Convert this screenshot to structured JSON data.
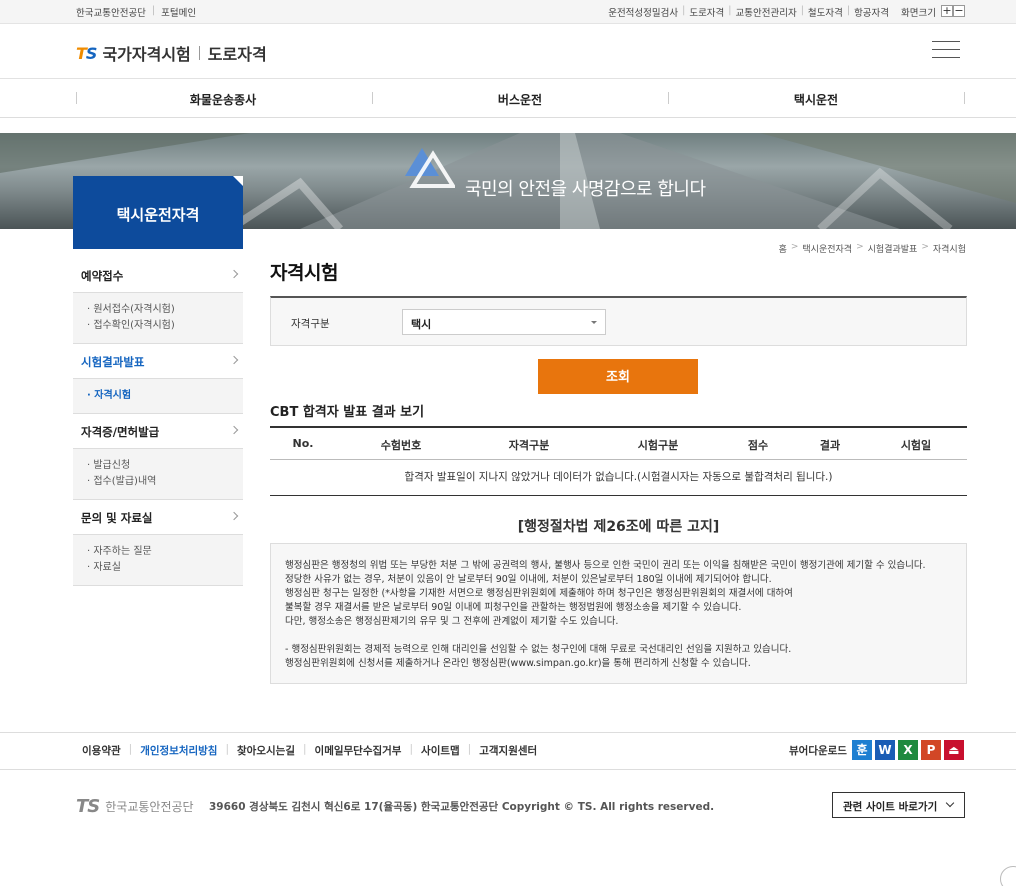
{
  "util": {
    "left_links": [
      "한국교통안전공단",
      "포털메인"
    ],
    "right_links": [
      "운전적성정밀검사",
      "도로자격",
      "교통안전관리자",
      "철도자격",
      "항공자격"
    ],
    "zoom_label": "화면크기",
    "zoom_in": "+",
    "zoom_out": "−"
  },
  "header": {
    "logo_t": "T",
    "logo_s": "S",
    "site_name": "국가자격시험",
    "section": "도로자격"
  },
  "gnb": [
    "화물운송종사",
    "버스운전",
    "택시운전"
  ],
  "hero": {
    "slogan": "국민의 안전을 사명감으로 합니다"
  },
  "side": {
    "title": "택시운전자격",
    "menu": [
      {
        "label": "예약접수",
        "subs": [
          "· 원서접수(자격시험)",
          "· 접수확인(자격시험)"
        ]
      },
      {
        "label": "시험결과발표",
        "subs": [
          "· 자격시험"
        ]
      },
      {
        "label": "자격증/면허발급",
        "subs": [
          "· 발급신청",
          "· 접수(발급)내역"
        ]
      },
      {
        "label": "문의 및 자료실",
        "subs": [
          "· 자주하는 질문",
          "· 자료실"
        ]
      }
    ]
  },
  "breadcrumb": [
    "홈",
    "택시운전자격",
    "시험결과발표",
    "자격시험"
  ],
  "page_title": "자격시험",
  "search": {
    "label": "자격구분",
    "selected": "택시",
    "button": "조회"
  },
  "results": {
    "title": "CBT 합격자 발표 결과 보기",
    "columns": [
      "No.",
      "수험번호",
      "자격구분",
      "시험구분",
      "점수",
      "결과",
      "시험일"
    ],
    "empty_message": "합격자 발표일이 지나지 않았거나 데이터가 없습니다.(시험결시자는 자동으로 불합격처리 됩니다.)"
  },
  "notice": {
    "title": "[행정절차법 제26조에 따른 고지]",
    "lines": [
      "행정심판은 행정청의 위법 또는 부당한 처분 그 밖에 공권력의 행사, 불행사 등으로 인한 국민이 권리 또는 이익을 침해받은 국민이 행정기관에 제기할 수 있습니다.",
      "정당한 사유가 없는 경우, 처분이 있음이 안 날로부터 90일 이내에, 처분이 있은날로부터 180일 이내에 제기되어야 합니다.",
      "행정심판 청구는 일정한 (*사항을 기재한 서면으로 행정심판위원회에 제출해야 하며 청구인은 행정심판위원회의 재결서에 대하여",
      "불복할 경우 재결서를 받은 날로부터 90일 이내에 피청구인을 관할하는 행정법원에 행정소송을 제기할 수 있습니다.",
      "다만, 행정소송은 행정심판제기의 유무 및 그 전후에 관계없이 제기할 수도 있습니다.",
      "",
      "- 행정심판위원회는 경제적 능력으로 인해 대리인을 선임할 수 없는 청구인에 대해 무료로 국선대리인 선임을 지원하고 있습니다.",
      "행정심판위원회에 신청서를 제출하거나 온라인 행정심판(www.simpan.go.kr)을 통해 편리하게 신청할 수 있습니다."
    ]
  },
  "footer": {
    "links": [
      "이용약관",
      "개인정보처리방침",
      "찾아오시는길",
      "이메일무단수집거부",
      "사이트맵",
      "고객지원센터"
    ],
    "viewer_label": "뷰어다운로드",
    "viewers": [
      {
        "label": "훈",
        "color": "#1e7fd1"
      },
      {
        "label": "W",
        "color": "#1a5db5"
      },
      {
        "label": "X",
        "color": "#1f8a3f"
      },
      {
        "label": "P",
        "color": "#d24726"
      },
      {
        "label": "⏏",
        "color": "#c8102e"
      }
    ],
    "logo_ts": "TS",
    "org": "한국교통안전공단",
    "address": "39660 경상북도 김천시 혁신6로 17(율곡동) 한국교통안전공단   Copyright © TS. All rights reserved.",
    "family_site": "관련 사이트 바로가기"
  }
}
